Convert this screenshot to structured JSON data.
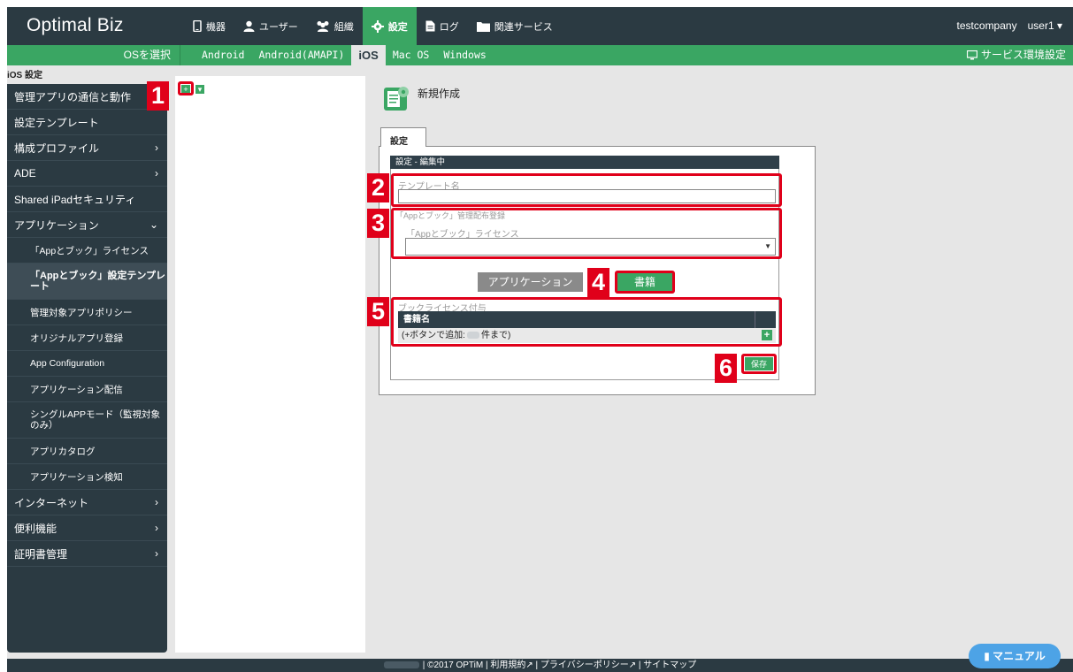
{
  "brand": "Optimal Biz",
  "top_nav": [
    {
      "label": "機器",
      "icon": "smartphone-icon"
    },
    {
      "label": "ユーザー",
      "icon": "user-icon"
    },
    {
      "label": "組織",
      "icon": "group-icon"
    },
    {
      "label": "設定",
      "icon": "gear-icon",
      "active": true
    },
    {
      "label": "ログ",
      "icon": "document-icon"
    },
    {
      "label": "関連サービス",
      "icon": "folder-icon"
    }
  ],
  "user": {
    "company": "testcompany",
    "name": "user1"
  },
  "os_bar": {
    "select_label": "OSを選択",
    "tabs": [
      "Android",
      "Android(AMAPI)",
      "iOS",
      "Mac OS",
      "Windows"
    ],
    "active_tab": "iOS",
    "service_settings": "サービス環境設定"
  },
  "sidebar": {
    "title": "iOS 設定",
    "items": [
      {
        "label": "管理アプリの通信と動作",
        "chevron": ""
      },
      {
        "label": "設定テンプレート",
        "chevron": ""
      },
      {
        "label": "構成プロファイル",
        "chevron": "›"
      },
      {
        "label": "ADE",
        "chevron": "›"
      },
      {
        "label": "Shared iPadセキュリティ",
        "chevron": ""
      },
      {
        "label": "アプリケーション",
        "chevron": "⌄"
      }
    ],
    "sub_items": [
      {
        "label": "「Appとブック」ライセンス"
      },
      {
        "label": "「Appとブック」設定テンプレート"
      },
      {
        "label": "管理対象アプリポリシー"
      },
      {
        "label": "オリジナルアプリ登録"
      },
      {
        "label": "App Configuration"
      },
      {
        "label": "アプリケーション配信"
      },
      {
        "label": "シングルAPPモード（監視対象のみ）"
      },
      {
        "label": "アプリカタログ"
      },
      {
        "label": "アプリケーション検知"
      }
    ],
    "bottom_items": [
      {
        "label": "インターネット",
        "chevron": "›"
      },
      {
        "label": "便利機能",
        "chevron": "›"
      },
      {
        "label": "証明書管理",
        "chevron": "›"
      }
    ]
  },
  "tree": {
    "add_symbol": "+",
    "menu_symbol": "▾"
  },
  "content": {
    "title": "新規作成",
    "tab_label": "設定",
    "form_header": "設定 - 編集中",
    "template_name_label": "テンプレート名",
    "template_name_value": "",
    "distribution_label": "「Appとブック」管理配布登録",
    "license_label": "「Appとブック」ライセンス",
    "license_value": "",
    "segment_app": "アプリケーション",
    "segment_book": "書籍",
    "book_license_label": "ブックライセンス付与",
    "book_table_header": "書籍名",
    "book_row_prefix": "(+ボタンで追加:",
    "book_row_suffix": "件まで)",
    "add_symbol": "+",
    "save_label": "保存"
  },
  "callouts": [
    "1",
    "2",
    "3",
    "4",
    "5",
    "6"
  ],
  "footer": {
    "copyright": "| ©2017 OPTiM |",
    "terms": "利用規約",
    "privacy": "プライバシーポリシー",
    "sitemap": "サイトマップ"
  },
  "manual_button": "マニュアル",
  "colors": {
    "dark": "#2b3a42",
    "green": "#3aa663",
    "red": "#e0001a",
    "blue": "#4da3e6"
  }
}
